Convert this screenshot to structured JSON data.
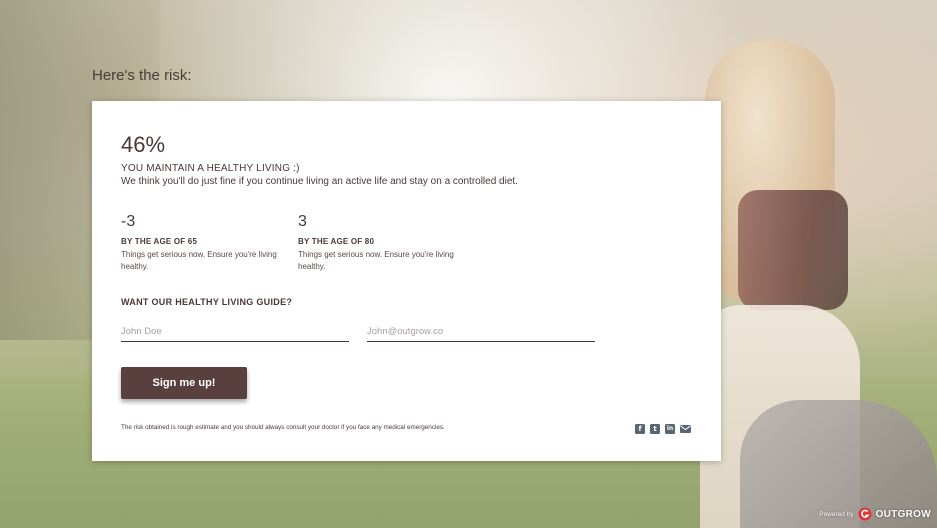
{
  "page": {
    "heading": "Here's the risk:"
  },
  "result": {
    "percent": "46%",
    "status_title": "YOU MAINTAIN A HEALTHY LIVING :)",
    "status_description": "We think you'll do just fine if you continue living an active life and stay on a controlled diet."
  },
  "stats": [
    {
      "value": "-3",
      "label": "BY THE AGE OF 65",
      "description": "Things get serious now. Ensure you're living healthy."
    },
    {
      "value": "3",
      "label": "BY THE AGE OF 80",
      "description": "Things get serious now. Ensure you're living healthy."
    }
  ],
  "lead_form": {
    "title": "WANT OUR HEALTHY LIVING GUIDE?",
    "name_placeholder": "John Doe",
    "name_value": "",
    "email_placeholder": "John@outgrow.co",
    "email_value": "",
    "submit_label": "Sign me up!"
  },
  "disclaimer": "The risk obtained is rough estimate and you should always consult your doctor if you face any medical emergencies.",
  "share": {
    "icons": [
      "facebook-icon",
      "twitter-icon",
      "linkedin-icon",
      "mail-icon"
    ],
    "facebook_glyph": "f",
    "twitter_glyph": "t",
    "linkedin_glyph": "in",
    "icon_color": "#5a6473"
  },
  "footer": {
    "powered_by": "Powered by",
    "brand": "OUTGROW",
    "brand_color": "#e4333a"
  },
  "colors": {
    "primary": "#5a3f3f",
    "text": "#4a3838",
    "card_bg": "#ffffff"
  }
}
